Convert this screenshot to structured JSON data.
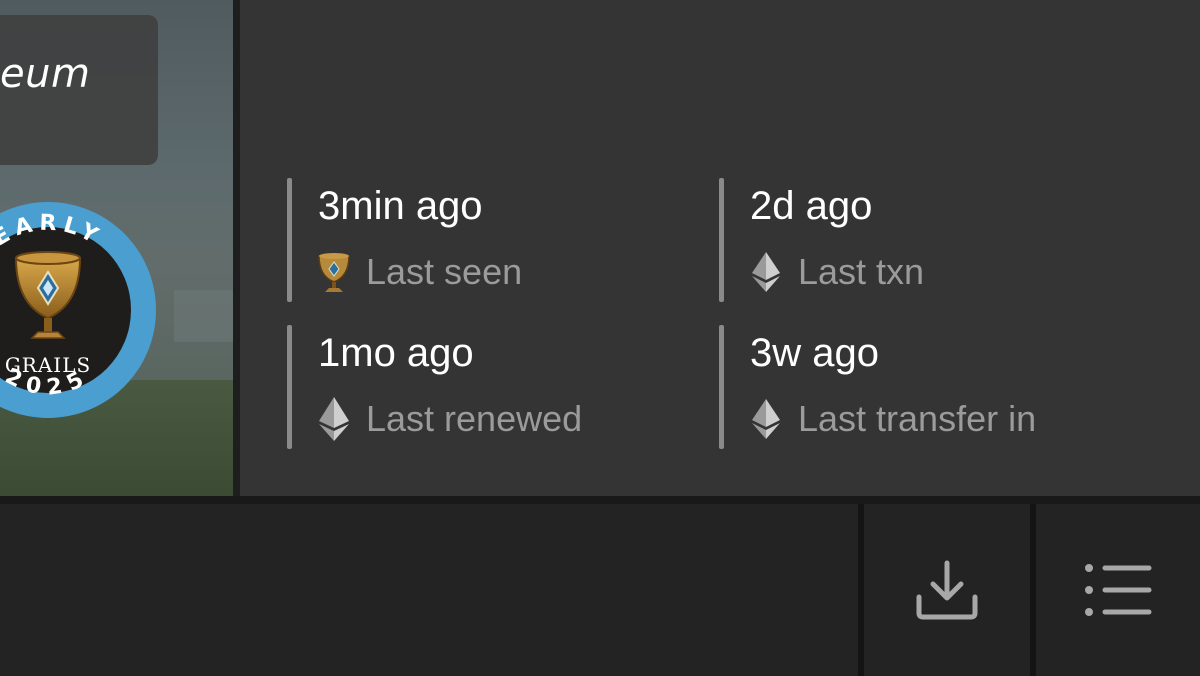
{
  "nft_image": {
    "title_fragment": "eum",
    "badge": {
      "top_text": "EARLY",
      "name": "GRAILS",
      "year": "2025",
      "ring_color": "#4a9fd0"
    }
  },
  "activity": [
    {
      "value": "3min ago",
      "label": "Last seen",
      "icon": "grail-cup-icon"
    },
    {
      "value": "2d ago",
      "label": "Last txn",
      "icon": "ethereum-icon"
    },
    {
      "value": "1mo ago",
      "label": "Last renewed",
      "icon": "ethereum-icon"
    },
    {
      "value": "3w ago",
      "label": "Last transfer in",
      "icon": "ethereum-icon"
    }
  ],
  "toolbar": {
    "download_icon": "download-icon",
    "menu_icon": "list-icon"
  },
  "colors": {
    "panel": "#343434",
    "bottom_bar": "#232323",
    "value_text": "#ffffff",
    "label_text": "#9b9b9b",
    "accent_bar": "#8a8a8a",
    "badge_ring": "#4a9fd0"
  }
}
